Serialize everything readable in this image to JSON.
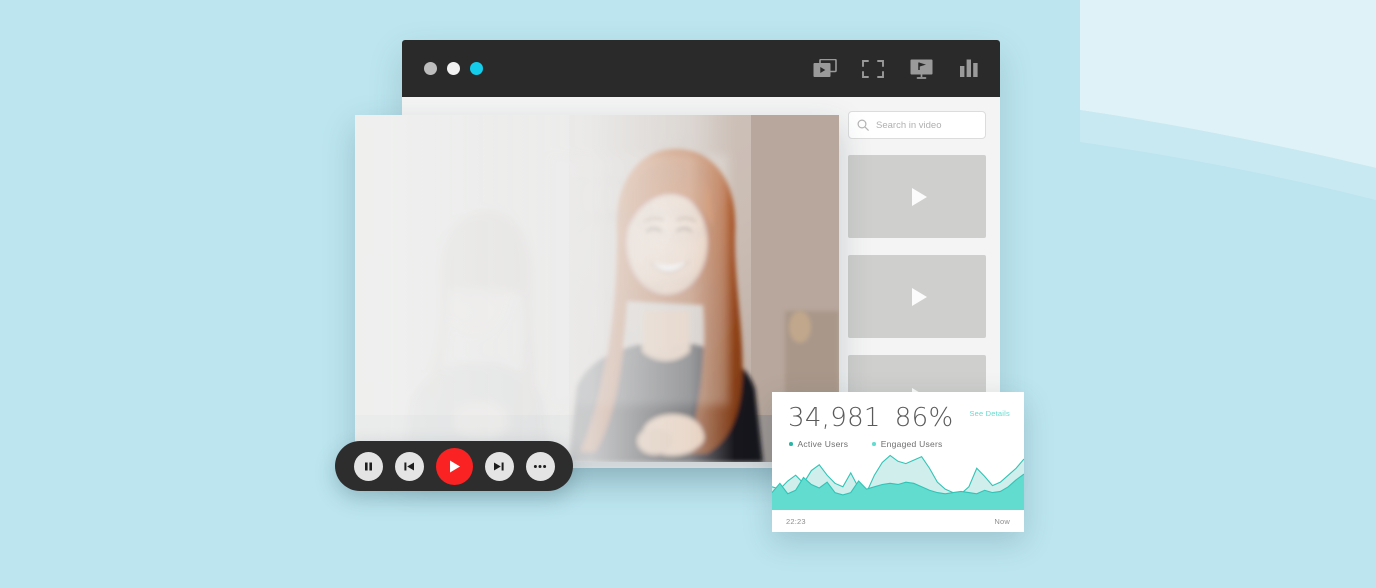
{
  "background": {
    "base_color": "#bce5ef",
    "wave_top_color": "#dff2f7",
    "wave_lower_color": "#bce5ef"
  },
  "browser_window": {
    "titlebar": {
      "color": "#2a2a2a",
      "dots": [
        {
          "name": "close",
          "color": "#bdbdbd"
        },
        {
          "name": "minimize",
          "color": "#f2f2f2"
        },
        {
          "name": "maximize",
          "color": "#14cdeb"
        }
      ],
      "icons": [
        {
          "name": "playlist-icon",
          "label": "Playlist"
        },
        {
          "name": "fullscreen-icon",
          "label": "Fullscreen"
        },
        {
          "name": "presentation-icon",
          "label": "Present"
        },
        {
          "name": "analytics-icon",
          "label": "Analytics"
        }
      ]
    }
  },
  "sidebar": {
    "search": {
      "placeholder": "Search in video",
      "value": "",
      "icon": "search-icon"
    },
    "thumbnails": [
      {
        "name": "video-thumbnail-1",
        "icon": "play-icon"
      },
      {
        "name": "video-thumbnail-2",
        "icon": "play-icon"
      },
      {
        "name": "video-thumbnail-3",
        "icon": "play-icon"
      }
    ]
  },
  "player": {
    "controls": [
      {
        "name": "pause-button",
        "icon": "pause-icon",
        "accent": false
      },
      {
        "name": "previous-button",
        "icon": "skip-back-icon",
        "accent": false
      },
      {
        "name": "play-button",
        "icon": "play-icon",
        "accent": true,
        "color": "#fa2222"
      },
      {
        "name": "next-button",
        "icon": "skip-forward-icon",
        "accent": false
      },
      {
        "name": "more-button",
        "icon": "ellipsis-icon",
        "accent": false
      }
    ]
  },
  "analytics": {
    "see_details_label": "See Details",
    "see_details_color": "#63dcd0",
    "metrics": [
      {
        "name": "active-users",
        "value": "34,981",
        "legend": "Active Users",
        "dot_color": "#2ab5a8"
      },
      {
        "name": "engaged-users",
        "value": "86%",
        "legend": "Engaged Users",
        "dot_color": "#63dcd0"
      }
    ],
    "axis": {
      "start_label": "22:23",
      "end_label": "Now"
    }
  },
  "chart_data": {
    "type": "area",
    "title": "",
    "xlabel": "",
    "ylabel": "",
    "x": [
      0,
      1,
      2,
      3,
      4,
      5,
      6,
      7,
      8,
      9,
      10,
      11,
      12,
      13,
      14,
      15,
      16,
      17,
      18,
      19,
      20,
      21,
      22,
      23,
      24,
      25,
      26,
      27,
      28,
      29,
      30,
      31,
      32
    ],
    "ylim": [
      0,
      100
    ],
    "grid": false,
    "legend_position": "top-left",
    "tick_labels": [
      "22:23",
      "Now"
    ],
    "series": [
      {
        "name": "Engaged Users",
        "fill": "#63dcd0",
        "stroke": "#2fc4b6",
        "values": [
          30,
          46,
          28,
          34,
          56,
          44,
          38,
          48,
          30,
          26,
          30,
          50,
          36,
          40,
          44,
          46,
          44,
          48,
          46,
          40,
          34,
          30,
          28,
          30,
          32,
          30,
          28,
          34,
          30,
          32,
          40,
          52,
          62
        ]
      },
      {
        "name": "Active Users",
        "fill": "rgba(120,205,200,0.35)",
        "stroke": "#2fc4b6",
        "values": [
          40,
          36,
          50,
          60,
          46,
          68,
          78,
          60,
          46,
          40,
          64,
          38,
          30,
          60,
          82,
          94,
          84,
          80,
          86,
          92,
          72,
          48,
          36,
          30,
          28,
          40,
          72,
          58,
          42,
          48,
          60,
          72,
          88
        ]
      }
    ]
  }
}
